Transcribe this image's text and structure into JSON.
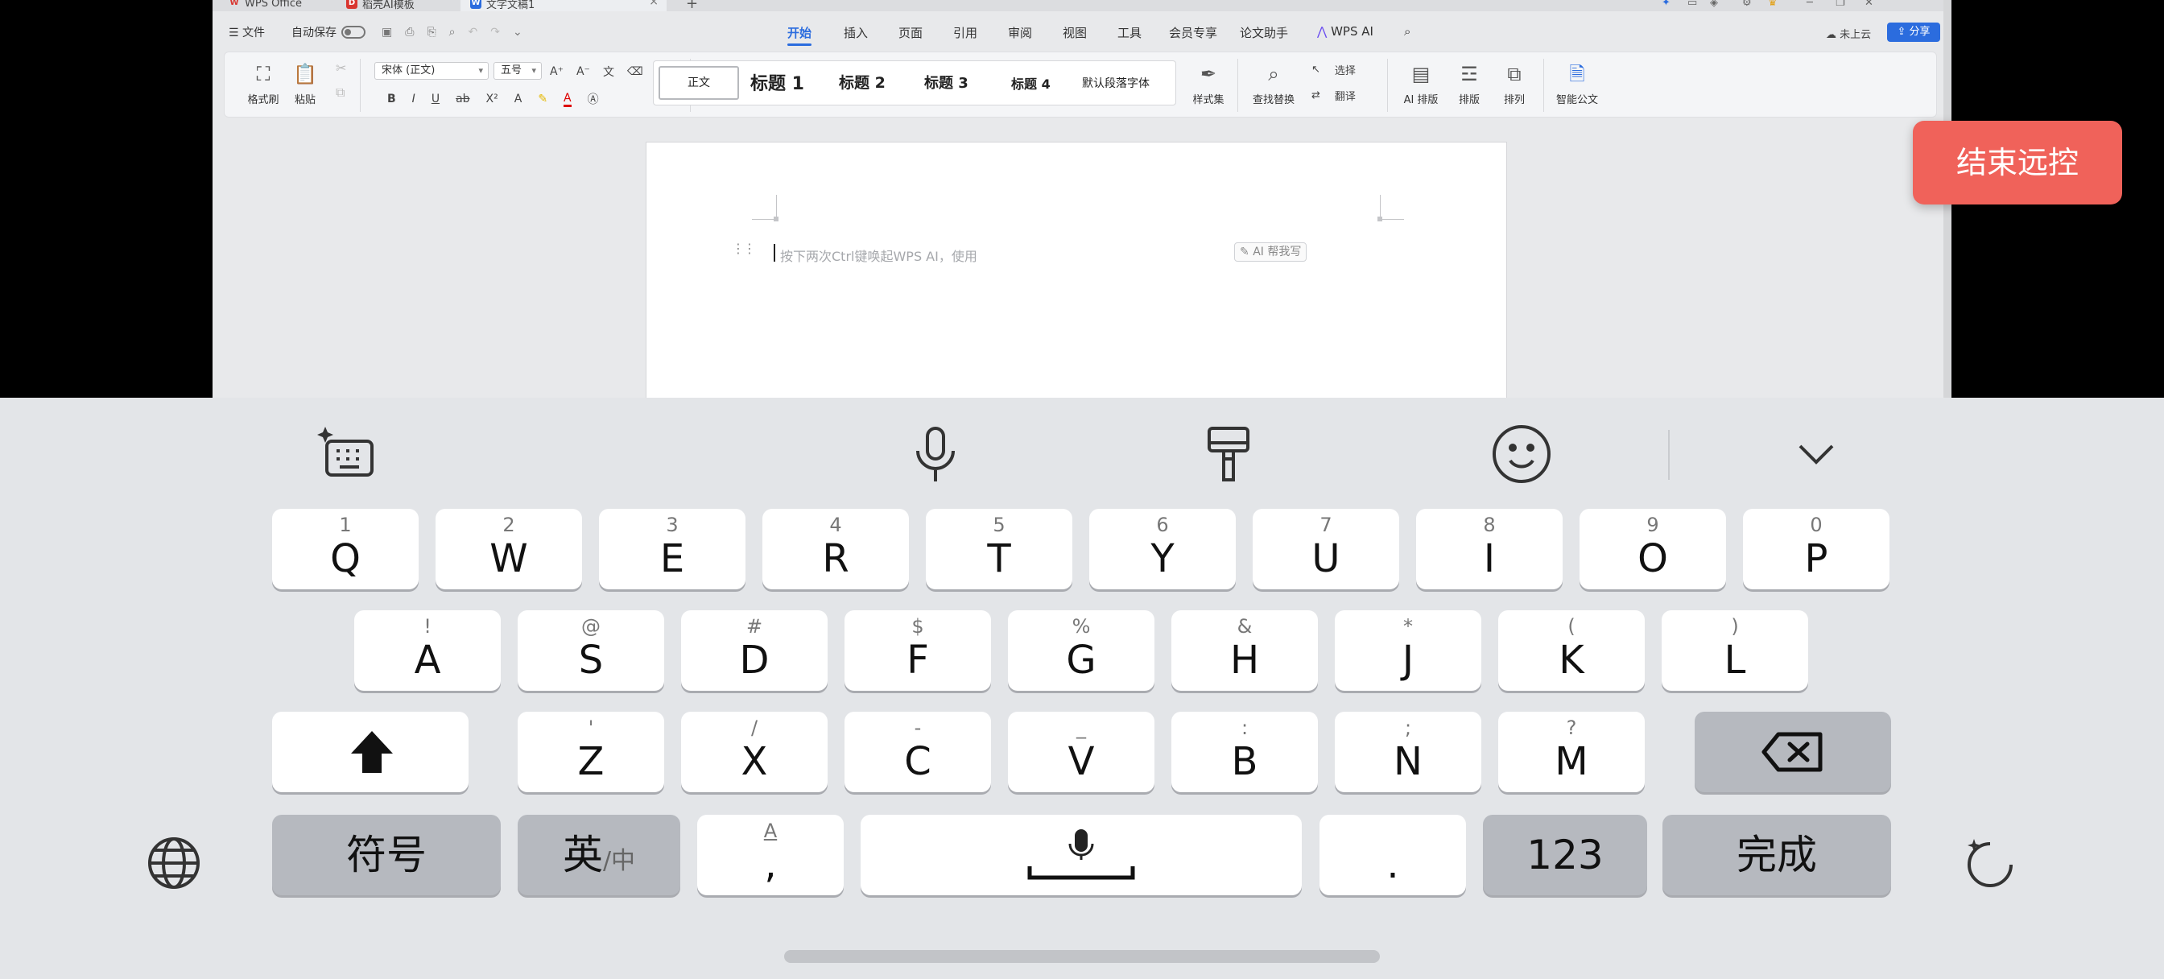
{
  "window": {
    "tabs": [
      "WPS Office",
      "稻壳AI模板",
      "文字文稿1"
    ],
    "close_glyph": "×",
    "plus_glyph": "+"
  },
  "menubar": {
    "file": "☰ 文件",
    "autosave": "自动保存",
    "tabs": [
      "开始",
      "插入",
      "页面",
      "引用",
      "审阅",
      "视图",
      "工具",
      "会员专享",
      "论文助手",
      "WPS AI"
    ],
    "active_tab": "开始",
    "cloud": "未上云",
    "share": "分享"
  },
  "ribbon": {
    "format_painter": "格式刷",
    "paste": "粘贴",
    "font_name": "宋体 (正文)",
    "font_size": "五号",
    "styles": [
      "正文",
      "标题 1",
      "标题 2",
      "标题 3",
      "标题 4",
      "默认段落字体"
    ],
    "style_set": "样式集",
    "find_replace": "查找替换",
    "select": "选择",
    "translate": "翻译",
    "ai_layout": "AI 排版",
    "layout": "排版",
    "arrange": "排列",
    "smart_doc": "智能公文"
  },
  "document": {
    "hint": "按下两次Ctrl键唤起WPS AI，使用",
    "ai_write": "AI 帮我写"
  },
  "remote": {
    "end_button": "结束远控"
  },
  "keyboard": {
    "row1": [
      {
        "main": "Q",
        "sub": "1"
      },
      {
        "main": "W",
        "sub": "2"
      },
      {
        "main": "E",
        "sub": "3"
      },
      {
        "main": "R",
        "sub": "4"
      },
      {
        "main": "T",
        "sub": "5"
      },
      {
        "main": "Y",
        "sub": "6"
      },
      {
        "main": "U",
        "sub": "7"
      },
      {
        "main": "I",
        "sub": "8"
      },
      {
        "main": "O",
        "sub": "9"
      },
      {
        "main": "P",
        "sub": "0"
      }
    ],
    "row2": [
      {
        "main": "A",
        "sub": "!"
      },
      {
        "main": "S",
        "sub": "@"
      },
      {
        "main": "D",
        "sub": "#"
      },
      {
        "main": "F",
        "sub": "$"
      },
      {
        "main": "G",
        "sub": "%"
      },
      {
        "main": "H",
        "sub": "&"
      },
      {
        "main": "J",
        "sub": "*"
      },
      {
        "main": "K",
        "sub": "("
      },
      {
        "main": "L",
        "sub": ")"
      }
    ],
    "row3": [
      {
        "main": "Z",
        "sub": "'"
      },
      {
        "main": "X",
        "sub": "/"
      },
      {
        "main": "C",
        "sub": "-"
      },
      {
        "main": "V",
        "sub": "_"
      },
      {
        "main": "B",
        "sub": ":"
      },
      {
        "main": "N",
        "sub": ";"
      },
      {
        "main": "M",
        "sub": "?"
      }
    ],
    "symbols": "符号",
    "lang_main": "英",
    "lang_sub": "/中",
    "comma_main": ",",
    "comma_sub": "A",
    "period": ".",
    "numbers": "123",
    "done": "完成"
  },
  "colors": {
    "accent": "#2b6cde",
    "end_remote": "#f0625a",
    "keyboard_bg": "#e3e5e8",
    "function_key": "#b6b9bf"
  }
}
